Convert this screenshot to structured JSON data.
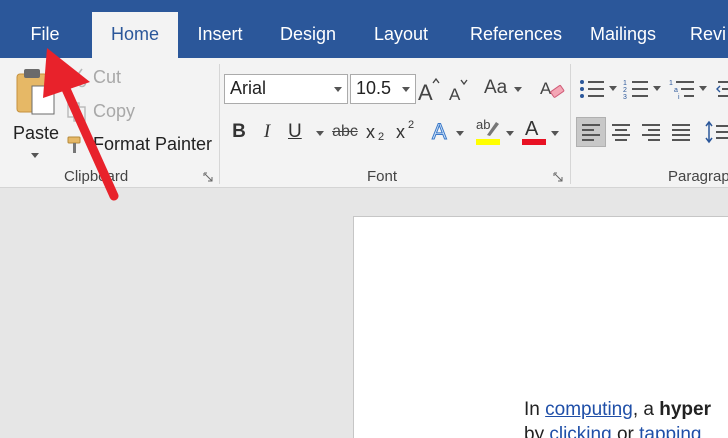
{
  "tabs": [
    {
      "label": "File"
    },
    {
      "label": "Home"
    },
    {
      "label": "Insert"
    },
    {
      "label": "Design"
    },
    {
      "label": "Layout"
    },
    {
      "label": "References"
    },
    {
      "label": "Mailings"
    },
    {
      "label": "Revi"
    }
  ],
  "active_tab": "Home",
  "clipboard": {
    "paste_label": "Paste",
    "cut_label": "Cut",
    "copy_label": "Copy",
    "format_painter_label": "Format Painter",
    "group_label": "Clipboard"
  },
  "font": {
    "font_name": "Arial",
    "font_size": "10.5",
    "change_case_label": "Aa",
    "bold_label": "B",
    "italic_label": "I",
    "underline_label": "U",
    "strikethrough_label": "abc",
    "subscript_label": "x",
    "subscript_mark": "2",
    "superscript_label": "x",
    "superscript_mark": "2",
    "text_effects_label": "A",
    "font_color_label": "A",
    "highlight_label": "ab",
    "group_label": "Font"
  },
  "paragraph": {
    "group_label": "Paragrap"
  },
  "document": {
    "line1": {
      "w1": "In",
      "w2": "computing",
      "w3": ", a",
      "w4": "hyper"
    },
    "line2": {
      "w1": "by",
      "w2": "clicking",
      "w3": "or",
      "w4": "tapping"
    }
  },
  "colors": {
    "tab_bar": "#2b579a",
    "ribbon": "#f3f3f3",
    "highlight_yellow": "#ffff00",
    "font_color_red": "#e81123",
    "annotation_arrow": "#e8222b",
    "link": "#1f4fa8"
  }
}
